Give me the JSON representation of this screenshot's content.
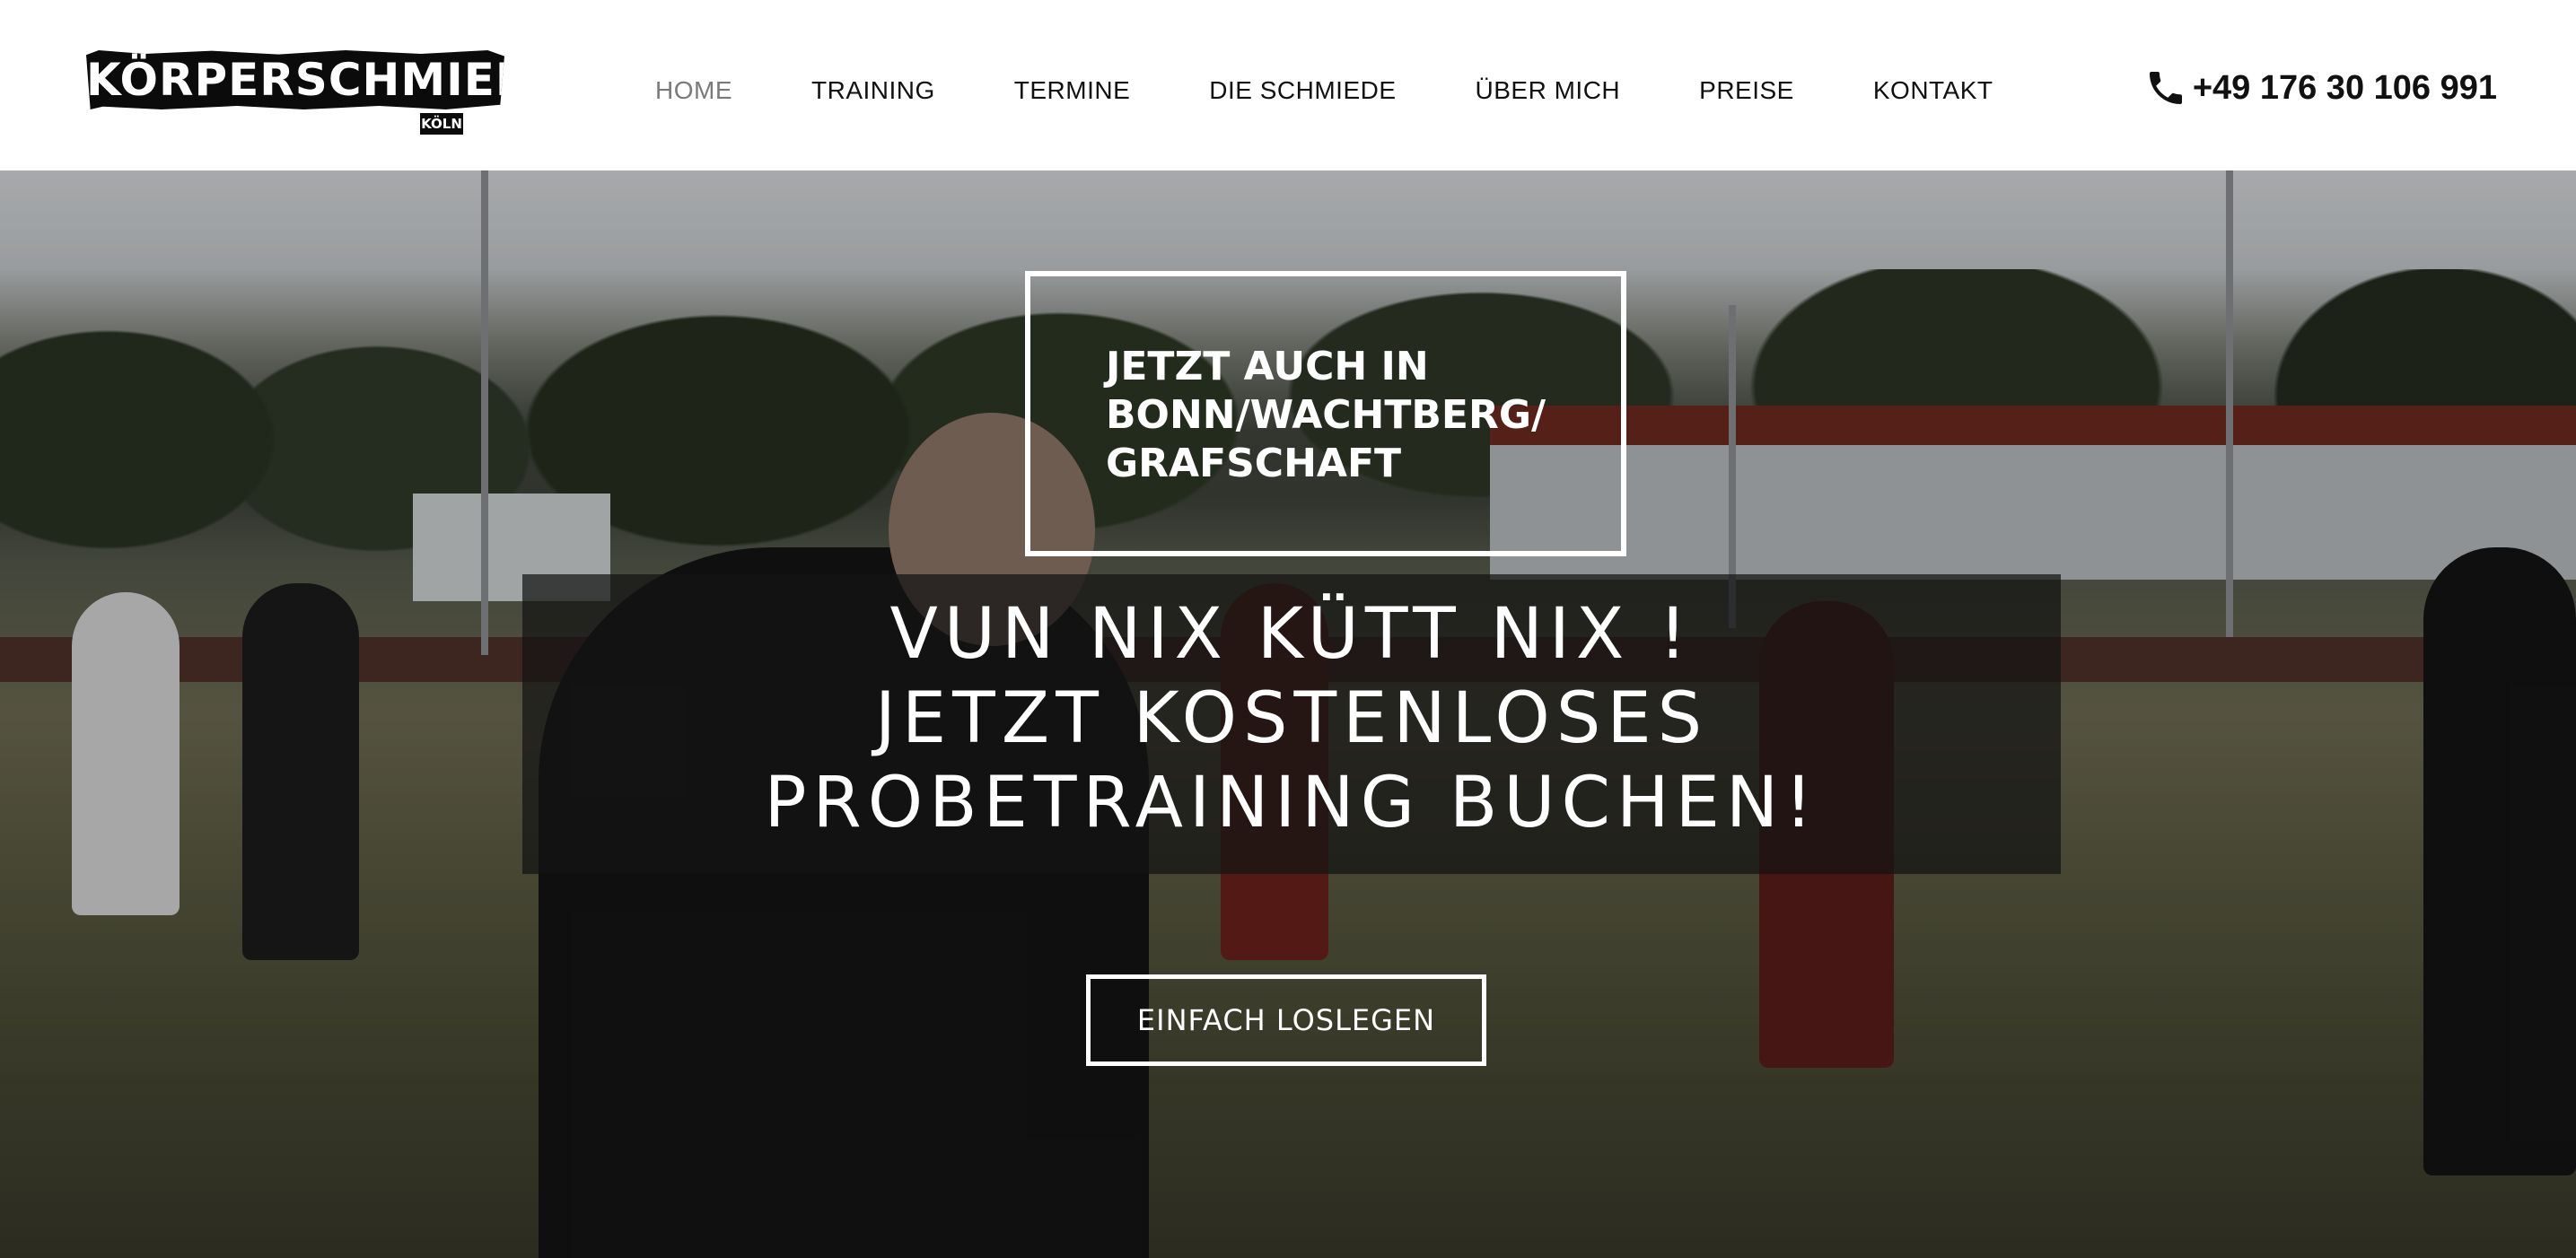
{
  "header": {
    "logo": {
      "main": "KÖRPERSCHMIEDE",
      "sub": "KÖLN"
    },
    "nav": [
      {
        "label": "HOME",
        "active": true
      },
      {
        "label": "TRAINING"
      },
      {
        "label": "TERMINE"
      },
      {
        "label": "DIE SCHMIEDE"
      },
      {
        "label": "ÜBER MICH"
      },
      {
        "label": "PREISE"
      },
      {
        "label": "KONTAKT"
      }
    ],
    "phone": {
      "icon": "phone-icon",
      "number": "+49 176 30 106 991"
    }
  },
  "hero": {
    "notice": "JETZT AUCH IN\nBONN/WACHTBERG/\nGRAFSCHAFT",
    "headline": "VUN NIX KÜTT NIX !\nJETZT KOSTENLOSES\nPROBETRAINING BUCHEN!",
    "cta_label": "EINFACH LOSLEGEN"
  },
  "colors": {
    "nav_active": "#7a7a7a",
    "text_dark": "#111111",
    "overlay": "#141414"
  }
}
